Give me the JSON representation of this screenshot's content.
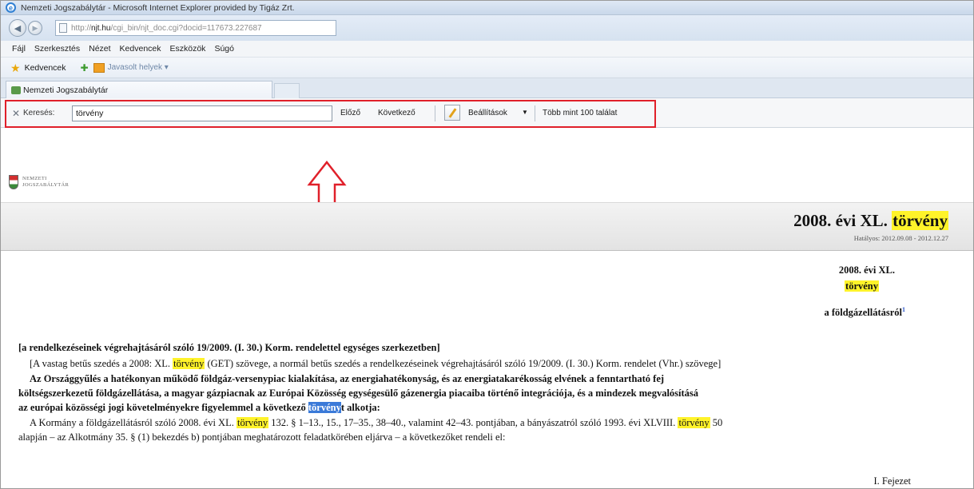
{
  "window": {
    "title": "Nemzeti Jogszabálytár - Microsoft Internet Explorer provided by Tigáz Zrt."
  },
  "address": {
    "url_prefix": "http://",
    "url_host": "njt.hu",
    "url_path": "/cgi_bin/njt_doc.cgi?docid=117673.227687"
  },
  "menu": [
    "Fájl",
    "Szerkesztés",
    "Nézet",
    "Kedvencek",
    "Eszközök",
    "Súgó"
  ],
  "favorites": {
    "label": "Kedvencek",
    "suggested": "Javasolt helyek ▾"
  },
  "tab": {
    "label": "Nemzeti Jogszabálytár"
  },
  "find": {
    "label": "Keresés:",
    "value": "törvény",
    "prev": "Előző",
    "next": "Következő",
    "settings": "Beállítások",
    "count": "Több mint 100 találat"
  },
  "site": {
    "logo_line1": "NEMZETI",
    "logo_line2": "JOGSZABÁLYTÁR"
  },
  "banner": {
    "title_a": "2008. évi XL.",
    "title_hl": "törvény",
    "validity": "Hatályos: 2012.09.08 - 2012.12.27"
  },
  "doc": {
    "h1": "2008. évi XL.",
    "h2": "törvény",
    "h3": "a földgázellátásról",
    "h3_note": "1",
    "p1": "[a rendelkezéseinek végrehajtásáról szóló 19/2009. (I. 30.) Korm. rendelettel egységes szerkezetben]",
    "p2a": "[A vastag betűs szedés a 2008: XL.",
    "p2hl": "törvény",
    "p2b": "(GET) szövege, a normál betűs szedés a rendelkezéseinek végrehajtásáról szóló 19/2009. (I. 30.) Korm. rendelet (Vhr.) szövege]",
    "p3": "Az Országgyűlés a hatékonyan működő földgáz-versenypiac kialakítása, az energiahatékonyság, és az energiatakarékosság elvének a fenntartható fej",
    "p4": "költségszerkezetű földgázellátása, a magyar gázpiacnak az Európai Közösség egységesülő gázenergia piacaiba történő integrációja, és a mindezek megvalósításá",
    "p5a": "az európai közösségi jogi követelményekre figyelemmel a következő",
    "p5cur": "törvény",
    "p5b": "t alkotja:",
    "p6a": "A Kormány a földgázellátásról szóló 2008. évi XL.",
    "p6hl1": "törvény",
    "p6b": "132. § 1–13., 15., 17–35., 38–40., valamint 42–43. pontjában, a bányászatról szóló 1993. évi XLVIII.",
    "p6hl2": "törvény",
    "p6c": "50",
    "p7": "alapján – az Alkotmány 35. § (1) bekezdés b) pontjában meghatározott feladatkörében eljárva – a következőket rendeli el:",
    "chapter": "I. Fejezet"
  }
}
